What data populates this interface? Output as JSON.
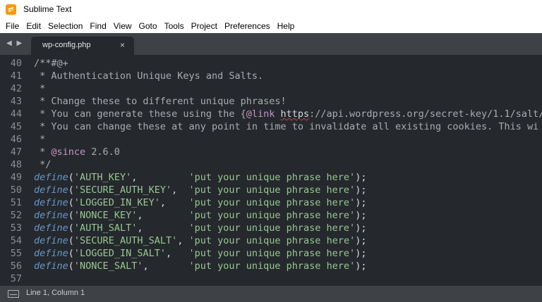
{
  "window": {
    "title": "Sublime Text"
  },
  "menu": [
    "File",
    "Edit",
    "Selection",
    "Find",
    "View",
    "Goto",
    "Tools",
    "Project",
    "Preferences",
    "Help"
  ],
  "tabs": [
    {
      "label": "wp-config.php",
      "close": "×"
    }
  ],
  "nav": {
    "arrows": "◀ ▶"
  },
  "editor": {
    "lines": [
      {
        "num": "40",
        "tokens": [
          {
            "t": "/**#@+",
            "c": "c-comment"
          }
        ]
      },
      {
        "num": "41",
        "tokens": [
          {
            "t": " * Authentication Unique Keys and Salts.",
            "c": "c-comment"
          }
        ]
      },
      {
        "num": "42",
        "tokens": [
          {
            "t": " *",
            "c": "c-comment"
          }
        ]
      },
      {
        "num": "43",
        "tokens": [
          {
            "t": " * Change these to different unique phrases!",
            "c": "c-comment"
          }
        ]
      },
      {
        "num": "44",
        "tokens": [
          {
            "t": " * You can generate these using the {",
            "c": "c-comment"
          },
          {
            "t": "@link",
            "c": "c-tag"
          },
          {
            "t": " ",
            "c": "c-comment"
          },
          {
            "t": "https",
            "c": "c-link"
          },
          {
            "t": "://api.wordpress.org/secret-key/1.1/salt/",
            "c": "c-comment"
          }
        ]
      },
      {
        "num": "45",
        "tokens": [
          {
            "t": " * You can change these at any point in time to invalidate all existing cookies. This wi",
            "c": "c-comment"
          }
        ]
      },
      {
        "num": "46",
        "tokens": [
          {
            "t": " *",
            "c": "c-comment"
          }
        ]
      },
      {
        "num": "47",
        "tokens": [
          {
            "t": " * ",
            "c": "c-comment"
          },
          {
            "t": "@since",
            "c": "c-tag"
          },
          {
            "t": " 2.6.0",
            "c": "c-comment"
          }
        ]
      },
      {
        "num": "48",
        "tokens": [
          {
            "t": " */",
            "c": "c-comment"
          }
        ]
      },
      {
        "num": "49",
        "tokens": [
          {
            "t": "define",
            "c": "c-func"
          },
          {
            "t": "(",
            "c": "c-punc"
          },
          {
            "t": "'AUTH_KEY'",
            "c": "c-str"
          },
          {
            "t": ",         ",
            "c": "c-punc"
          },
          {
            "t": "'put your unique phrase here'",
            "c": "c-str"
          },
          {
            "t": ");",
            "c": "c-punc"
          }
        ]
      },
      {
        "num": "50",
        "tokens": [
          {
            "t": "define",
            "c": "c-func"
          },
          {
            "t": "(",
            "c": "c-punc"
          },
          {
            "t": "'SECURE_AUTH_KEY'",
            "c": "c-str"
          },
          {
            "t": ",  ",
            "c": "c-punc"
          },
          {
            "t": "'put your unique phrase here'",
            "c": "c-str"
          },
          {
            "t": ");",
            "c": "c-punc"
          }
        ]
      },
      {
        "num": "51",
        "tokens": [
          {
            "t": "define",
            "c": "c-func"
          },
          {
            "t": "(",
            "c": "c-punc"
          },
          {
            "t": "'LOGGED_IN_KEY'",
            "c": "c-str"
          },
          {
            "t": ",    ",
            "c": "c-punc"
          },
          {
            "t": "'put your unique phrase here'",
            "c": "c-str"
          },
          {
            "t": ");",
            "c": "c-punc"
          }
        ]
      },
      {
        "num": "52",
        "tokens": [
          {
            "t": "define",
            "c": "c-func"
          },
          {
            "t": "(",
            "c": "c-punc"
          },
          {
            "t": "'NONCE_KEY'",
            "c": "c-str"
          },
          {
            "t": ",        ",
            "c": "c-punc"
          },
          {
            "t": "'put your unique phrase here'",
            "c": "c-str"
          },
          {
            "t": ");",
            "c": "c-punc"
          }
        ]
      },
      {
        "num": "53",
        "tokens": [
          {
            "t": "define",
            "c": "c-func"
          },
          {
            "t": "(",
            "c": "c-punc"
          },
          {
            "t": "'AUTH_SALT'",
            "c": "c-str"
          },
          {
            "t": ",        ",
            "c": "c-punc"
          },
          {
            "t": "'put your unique phrase here'",
            "c": "c-str"
          },
          {
            "t": ");",
            "c": "c-punc"
          }
        ]
      },
      {
        "num": "54",
        "tokens": [
          {
            "t": "define",
            "c": "c-func"
          },
          {
            "t": "(",
            "c": "c-punc"
          },
          {
            "t": "'SECURE_AUTH_SALT'",
            "c": "c-str"
          },
          {
            "t": ", ",
            "c": "c-punc"
          },
          {
            "t": "'put your unique phrase here'",
            "c": "c-str"
          },
          {
            "t": ");",
            "c": "c-punc"
          }
        ]
      },
      {
        "num": "55",
        "tokens": [
          {
            "t": "define",
            "c": "c-func"
          },
          {
            "t": "(",
            "c": "c-punc"
          },
          {
            "t": "'LOGGED_IN_SALT'",
            "c": "c-str"
          },
          {
            "t": ",   ",
            "c": "c-punc"
          },
          {
            "t": "'put your unique phrase here'",
            "c": "c-str"
          },
          {
            "t": ");",
            "c": "c-punc"
          }
        ]
      },
      {
        "num": "56",
        "tokens": [
          {
            "t": "define",
            "c": "c-func"
          },
          {
            "t": "(",
            "c": "c-punc"
          },
          {
            "t": "'NONCE_SALT'",
            "c": "c-str"
          },
          {
            "t": ",       ",
            "c": "c-punc"
          },
          {
            "t": "'put your unique phrase here'",
            "c": "c-str"
          },
          {
            "t": ");",
            "c": "c-punc"
          }
        ]
      },
      {
        "num": "57",
        "tokens": []
      }
    ]
  },
  "status": {
    "position": "Line 1, Column 1"
  },
  "colors": {
    "accent": "#ff9800",
    "editor_bg": "#25282c",
    "chrome_bg": "#3e4247"
  }
}
